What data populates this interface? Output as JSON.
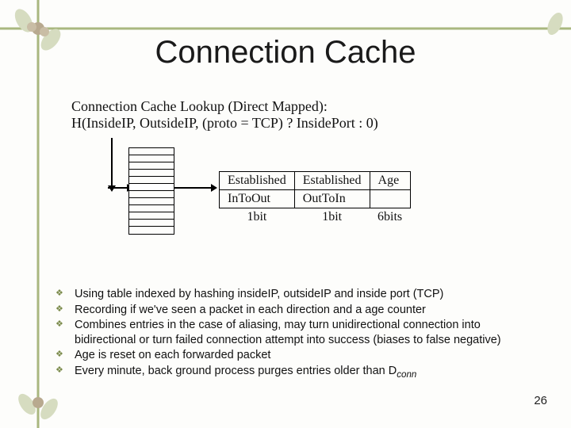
{
  "title": "Connection Cache",
  "diagram": {
    "caption_line1": "Connection Cache Lookup (Direct Mapped):",
    "caption_line2": "H(InsideIP, OutsideIP, (proto = TCP) ? InsidePort : 0)",
    "entry": {
      "headers": [
        "Established",
        "Established",
        "Age"
      ],
      "subheaders": [
        "InToOut",
        "OutToIn",
        ""
      ],
      "sizes": [
        "1bit",
        "1bit",
        "6bits"
      ]
    }
  },
  "bullets": [
    "Using table indexed by hashing insideIP, outsideIP and inside port (TCP)",
    "Recording if we've seen a packet in each direction and a age counter",
    "Combines entries in the case of aliasing, may turn unidirectional connection into bidirectional or turn failed connection attempt into success (biases to false negative)",
    "Age is reset on each forwarded packet",
    "Every minute, back ground process purges entries older than D"
  ],
  "bullet5_subscript": "conn",
  "page_number": "26",
  "decor": {
    "stem_color": "#a9b77f",
    "leaf_light": "#d6dcc0",
    "flower": "#b8a98f"
  }
}
